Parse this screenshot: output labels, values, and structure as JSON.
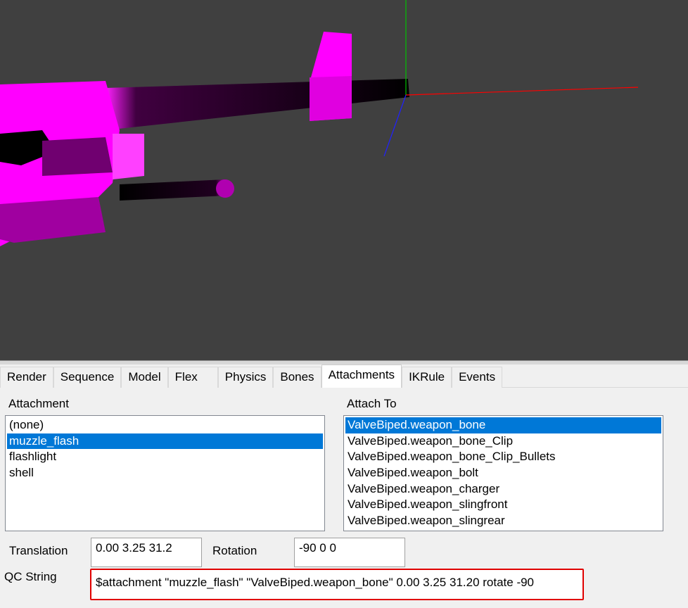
{
  "colors": {
    "viewport_bg": "#404040",
    "model": "#ff00ff",
    "selection": "#0078d7",
    "highlight_box": "#e00000",
    "axis_x": "#ff0000",
    "axis_y": "#00c000",
    "axis_z": "#2020ff"
  },
  "tabs": [
    {
      "label": "Render"
    },
    {
      "label": "Sequence"
    },
    {
      "label": "Model"
    },
    {
      "label": "Flex"
    },
    {
      "label": "Physics"
    },
    {
      "label": "Bones"
    },
    {
      "label": "Attachments",
      "active": true
    },
    {
      "label": "IKRule"
    },
    {
      "label": "Events"
    }
  ],
  "attachment": {
    "label": "Attachment",
    "items": [
      "(none)",
      "muzzle_flash",
      "flashlight",
      "shell"
    ],
    "selected": "muzzle_flash"
  },
  "attach_to": {
    "label": "Attach To",
    "items": [
      "ValveBiped.weapon_bone",
      "ValveBiped.weapon_bone_Clip",
      "ValveBiped.weapon_bone_Clip_Bullets",
      "ValveBiped.weapon_bolt",
      "ValveBiped.weapon_charger",
      "ValveBiped.weapon_slingfront",
      "ValveBiped.weapon_slingrear"
    ],
    "selected": "ValveBiped.weapon_bone"
  },
  "translation": {
    "label": "Translation",
    "value": "0.00 3.25 31.2"
  },
  "rotation": {
    "label": "Rotation",
    "value": "-90 0 0"
  },
  "qc": {
    "label": "QC String",
    "value": "$attachment \"muzzle_flash\" \"ValveBiped.weapon_bone\" 0.00 3.25 31.20 rotate -90"
  }
}
